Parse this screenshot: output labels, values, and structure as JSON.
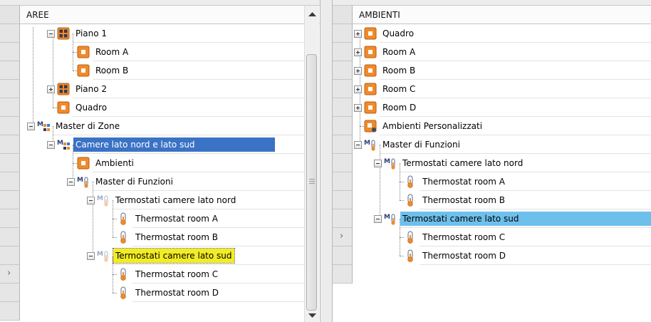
{
  "left_panel": {
    "header": "AREE",
    "nodes": [
      {
        "label": "Piano 1",
        "icon": "grid-area-icon",
        "expander": "minus"
      },
      {
        "label": "Room A",
        "icon": "room-icon"
      },
      {
        "label": "Room B",
        "icon": "room-icon"
      },
      {
        "label": "Piano 2",
        "icon": "grid-area-icon",
        "expander": "plus"
      },
      {
        "label": "Quadro",
        "icon": "room-icon"
      },
      {
        "label": "Master di Zone",
        "icon": "master-zone-icon",
        "expander": "minus"
      },
      {
        "label": "Camere lato nord e lato sud",
        "icon": "master-zone-icon",
        "expander": "minus",
        "selected": "blue"
      },
      {
        "label": "Ambienti",
        "icon": "room-icon"
      },
      {
        "label": "Master di Funzioni",
        "icon": "master-function-icon",
        "expander": "minus"
      },
      {
        "label": "Termostati camere lato nord",
        "icon": "master-function-faded-icon",
        "expander": "minus"
      },
      {
        "label": "Thermostat room A",
        "icon": "thermometer-icon"
      },
      {
        "label": "Thermostat room B",
        "icon": "thermometer-icon"
      },
      {
        "label": "Termostati camere lato sud",
        "icon": "master-function-faded-icon",
        "expander": "minus",
        "selected": "yellow"
      },
      {
        "label": "Thermostat room C",
        "icon": "thermometer-icon"
      },
      {
        "label": "Thermostat room D",
        "icon": "thermometer-icon"
      }
    ],
    "current_row_marker": "›"
  },
  "right_panel": {
    "header": "AMBIENTI",
    "nodes": [
      {
        "label": "Quadro",
        "icon": "room-icon",
        "expander": "plus"
      },
      {
        "label": "Room A",
        "icon": "room-icon",
        "expander": "plus"
      },
      {
        "label": "Room B",
        "icon": "room-icon",
        "expander": "plus"
      },
      {
        "label": "Room C",
        "icon": "room-icon",
        "expander": "plus"
      },
      {
        "label": "Room D",
        "icon": "room-icon",
        "expander": "plus"
      },
      {
        "label": "Ambienti Personalizzati",
        "icon": "custom-room-icon"
      },
      {
        "label": "Master di Funzioni",
        "icon": "master-function-icon",
        "expander": "minus"
      },
      {
        "label": "Termostati camere lato nord",
        "icon": "master-function-icon",
        "expander": "minus"
      },
      {
        "label": "Thermostat room A",
        "icon": "thermometer-icon"
      },
      {
        "label": "Thermostat room B",
        "icon": "thermometer-icon"
      },
      {
        "label": "Termostati camere lato sud",
        "icon": "master-function-icon",
        "expander": "minus",
        "selected": "light"
      },
      {
        "label": "Thermostat room C",
        "icon": "thermometer-icon"
      },
      {
        "label": "Thermostat room D",
        "icon": "thermometer-icon"
      }
    ],
    "current_row_marker": "›"
  },
  "colors": {
    "selection_blue": "#3a73c5",
    "selection_yellow": "#f2ec24",
    "selection_light_blue": "#6ec0ec",
    "icon_orange": "#f08a2a"
  }
}
